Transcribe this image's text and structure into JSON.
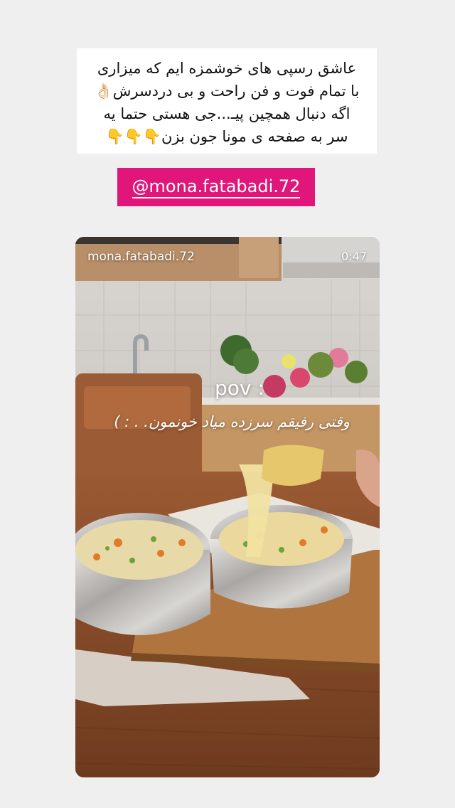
{
  "caption": {
    "lines": [
      "عاشق  رسپی های خوشمزه ایم که میزاری",
      "با تمام فوت و فن راحت و بی دردسرش👌🏻",
      "اگه دنبال همچین پیـ...جی هستی حتما یه",
      "سر به صفحه ی مونا جون بزن👇👇👇"
    ]
  },
  "mention": {
    "text": "@mona.fatabadi.72",
    "bg_color": "#e0167b"
  },
  "story_video": {
    "username": "mona.fatabadi.72",
    "duration": "0:47",
    "overlay_title": "pov :",
    "overlay_text": "وقتی رفیقم سرزده میاد خونمون. . : )"
  },
  "colors": {
    "page_bg": "#efefef",
    "caption_bg": "#ffffff",
    "text": "#111111"
  }
}
